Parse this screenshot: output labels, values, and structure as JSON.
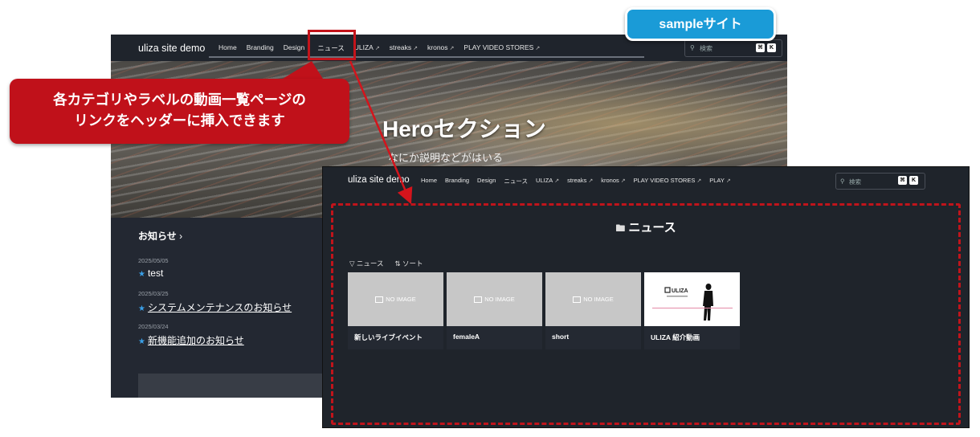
{
  "back": {
    "brand": "uliza site demo",
    "nav": [
      "Home",
      "Branding",
      "Design",
      "ニュース",
      "ULIZA",
      "streaks",
      "kronos",
      "PLAY VIDEO STORES"
    ],
    "search_placeholder": "検索",
    "kbd": [
      "⌘",
      "K"
    ],
    "hero_title": "Heroセクション",
    "hero_subtitle": "なにか説明などがはいる",
    "news_heading": "お知らせ",
    "news": [
      {
        "date": "2025/05/05",
        "title": "test"
      },
      {
        "date": "2025/03/25",
        "title": "システムメンテナンスのお知らせ"
      },
      {
        "date": "2025/03/24",
        "title": "新機能追加のお知らせ"
      }
    ]
  },
  "front": {
    "brand": "uliza site demo",
    "nav": [
      "Home",
      "Branding",
      "Design",
      "ニュース",
      "ULIZA",
      "streaks",
      "kronos",
      "PLAY VIDEO STORES",
      "PLAY"
    ],
    "search_placeholder": "検索",
    "kbd": [
      "⌘",
      "K"
    ],
    "page_title": "ニュース",
    "filters": [
      "ニュース",
      "ソート"
    ],
    "no_image": "NO IMAGE",
    "cards": [
      {
        "title": "新しいライブイベント"
      },
      {
        "title": "femaleA"
      },
      {
        "title": "short"
      },
      {
        "title": "ULIZA 紹介動画",
        "thumb_logo": "ULIZA"
      }
    ]
  },
  "overlays": {
    "badge": "sampleサイト",
    "callout_line1": "各カテゴリやラベルの動画一覧ページの",
    "callout_line2": "リンクをヘッダーに挿入できます"
  },
  "colors": {
    "callout": "#c0111a",
    "badge": "#1a9bd7",
    "dark_bg": "#1f242b",
    "star": "#3aa0e8"
  }
}
